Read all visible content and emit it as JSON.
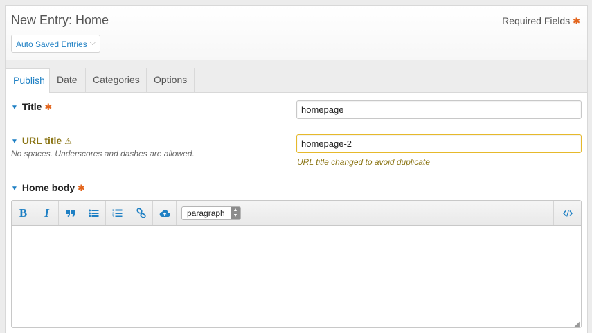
{
  "header": {
    "title": "New Entry: Home",
    "required_note": "Required Fields",
    "autosave_label": "Auto Saved Entries"
  },
  "tabs": [
    {
      "label": "Publish",
      "active": true
    },
    {
      "label": "Date",
      "active": false
    },
    {
      "label": "Categories",
      "active": false
    },
    {
      "label": "Options",
      "active": false
    }
  ],
  "fields": {
    "title": {
      "label": "Title",
      "value": "homepage"
    },
    "url_title": {
      "label": "URL title",
      "hint": "No spaces. Underscores and dashes are allowed.",
      "value": "homepage-2",
      "warning": "URL title changed to avoid duplicate"
    },
    "home_body": {
      "label": "Home body",
      "format_selected": "paragraph"
    }
  },
  "icons": {
    "required": "asterisk-icon",
    "warning": "warning-triangle-icon",
    "collapse": "chevron-down-icon"
  },
  "colors": {
    "accent": "#1f80c4",
    "required": "#e3651d",
    "warning": "#8a7414",
    "warning_border": "#e6b92b"
  },
  "toolbar": {
    "bold": "B",
    "italic": "I"
  }
}
